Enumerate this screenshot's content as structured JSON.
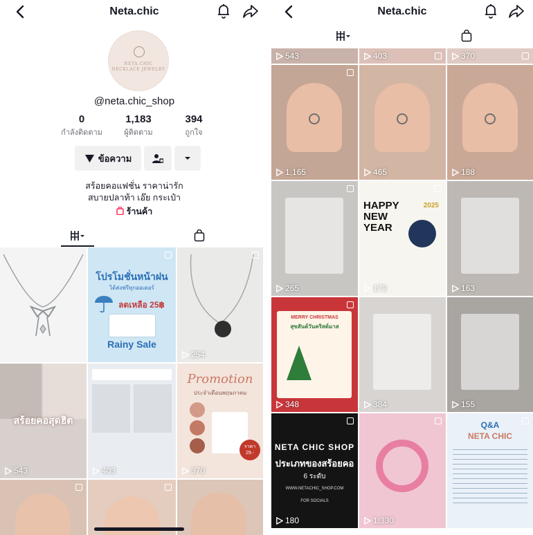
{
  "profile": {
    "title": "Neta.chic",
    "handle": "@neta.chic_shop",
    "avatar_lines": [
      "NETA.CHIC",
      "NECKLACE JEWELRY"
    ],
    "stats": [
      {
        "value": "0",
        "label": "กำลังติดตาม"
      },
      {
        "value": "1,183",
        "label": "ผู้ติดตาม"
      },
      {
        "value": "394",
        "label": "ถูกใจ"
      }
    ],
    "message_button": "ข้อความ",
    "bio_lines": [
      "สร้อยคอแฟชั่น ราคาน่ารัก",
      "สบายปลาท้า เอ๊ย กระเป๋า"
    ],
    "shop_label": "ร้านค้า"
  },
  "left_grid": [
    {
      "views": "",
      "caption": "",
      "bg": "#f4f4f4"
    },
    {
      "views": "",
      "caption": "โปรโมชั่นหน้าฝน",
      "sub": "ได้ส่งฟรีทุกออเดอร์",
      "price": "ลดเหลือ 25฿",
      "sale": "Rainy Sale",
      "bg": "#cfe6f4"
    },
    {
      "views": "254",
      "caption": "",
      "bg": "#eaeae8"
    },
    {
      "views": "543",
      "caption": "สร้อยคอสุดฮิต",
      "bg": "#d8d0cc"
    },
    {
      "views": "403",
      "caption": "",
      "bg": "#e9ecf0"
    },
    {
      "views": "370",
      "caption": "Promotion",
      "sub": "ประจำเดือนพฤษภาคม",
      "price": "ราคา 29.-",
      "bg": "#f3e4dc"
    },
    {
      "views": "",
      "caption": "",
      "bg": "#d9c2b4"
    },
    {
      "views": "",
      "caption": "",
      "bg": "#e4cdbf"
    },
    {
      "views": "",
      "caption": "",
      "bg": "#dcc6b8"
    }
  ],
  "right_grid": [
    {
      "views": "543",
      "bg": "#c9b2a9"
    },
    {
      "views": "403",
      "bg": "#dcc0b8"
    },
    {
      "views": "370",
      "bg": "#e0cac5"
    },
    {
      "views": "1,165",
      "bg": "#c4a696"
    },
    {
      "views": "465",
      "bg": "#d3b5a4"
    },
    {
      "views": "188",
      "bg": "#caa897"
    },
    {
      "views": "265",
      "bg": "#c8c6c3"
    },
    {
      "views": "172",
      "caption": "HAPPY NEW YEAR",
      "year": "2025",
      "bg": "#f7f5ef"
    },
    {
      "views": "163",
      "bg": "#bdb8b3"
    },
    {
      "views": "348",
      "caption": "MERRY CHRISTMAS",
      "sub": "สุขสันต์วันคริสต์มาส",
      "bg": "#c9363a"
    },
    {
      "views": "384",
      "bg": "#d8d4d1"
    },
    {
      "views": "155",
      "bg": "#a9a5a1"
    },
    {
      "views": "180",
      "caption": "NETA CHIC SHOP",
      "sub": "ประเภทของสร้อยคอ",
      "sub2": "6 ระดับ",
      "link": "WWW.NETACHIC_SHOP.COM",
      "social": "FOR SOCIALS",
      "bg": "#141414"
    },
    {
      "views": "1,330",
      "bg": "#f0c6d2"
    },
    {
      "views": "",
      "caption": "Q&A",
      "sub": "NETA CHIC",
      "bg": "#eaf1f8"
    }
  ],
  "colors": {
    "text": "#161823",
    "muted": "#6f7077",
    "button_bg": "#f1f1f2",
    "shop_accent": "#fe2c55",
    "promo_blue": "#2a6fb7",
    "promo_pink": "#c97a63"
  }
}
